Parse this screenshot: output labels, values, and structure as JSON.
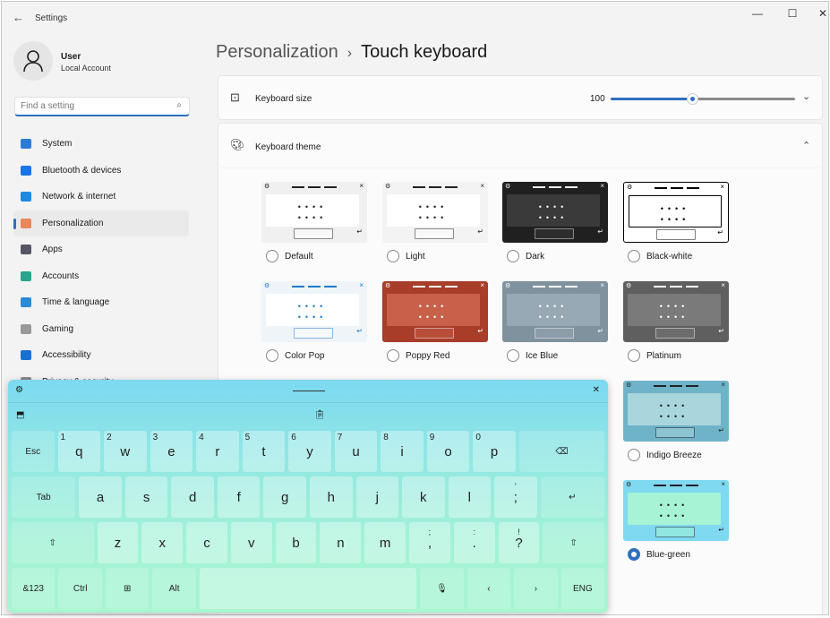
{
  "window": {
    "title": "Settings",
    "back": "←",
    "minimize": "—",
    "maximize": "☐",
    "close": "✕"
  },
  "user": {
    "name": "User",
    "account": "Local Account"
  },
  "search": {
    "placeholder": "Find a setting",
    "icon": "search-icon"
  },
  "sidebar": {
    "items": [
      {
        "label": "System",
        "color": "#2b7bd6"
      },
      {
        "label": "Bluetooth & devices",
        "color": "#1a73e8"
      },
      {
        "label": "Network & internet",
        "color": "#1e88e5"
      },
      {
        "label": "Personalization",
        "color": "#e8875a",
        "active": true
      },
      {
        "label": "Apps",
        "color": "#556"
      },
      {
        "label": "Accounts",
        "color": "#28a58e"
      },
      {
        "label": "Time & language",
        "color": "#2b8bd6"
      },
      {
        "label": "Gaming",
        "color": "#999"
      },
      {
        "label": "Accessibility",
        "color": "#1a6fd6"
      },
      {
        "label": "Privacy & security",
        "color": "#888"
      }
    ]
  },
  "breadcrumb": {
    "parent": "Personalization",
    "separator": "›",
    "current": "Touch keyboard"
  },
  "keyboard_size": {
    "label": "Keyboard size",
    "value": "100",
    "fraction": 0.44
  },
  "keyboard_theme": {
    "label": "Keyboard theme"
  },
  "themes": [
    {
      "name": "Default",
      "bg": "#f0f0f0",
      "panel": "#ffffff",
      "fg": "#222",
      "selected": false
    },
    {
      "name": "Light",
      "bg": "#f3f3f3",
      "panel": "#ffffff",
      "fg": "#222",
      "selected": false
    },
    {
      "name": "Dark",
      "bg": "#202020",
      "panel": "#3a3a3a",
      "fg": "#eee",
      "selected": false
    },
    {
      "name": "Black-white",
      "bg": "#ffffff",
      "panel": "#ffffff",
      "fg": "#000",
      "selected": false,
      "outline": true
    },
    {
      "name": "Color Pop",
      "bg": "#eef4f8",
      "panel": "#ffffff",
      "fg": "#1f7ac9",
      "selected": false
    },
    {
      "name": "Poppy Red",
      "bg": "#a83d2a",
      "panel": "#c8604a",
      "fg": "#fff",
      "selected": false
    },
    {
      "name": "Ice Blue",
      "bg": "#7f929e",
      "panel": "#97a9b4",
      "fg": "#fff",
      "selected": false
    },
    {
      "name": "Platinum",
      "bg": "#5f5f5f",
      "panel": "#7a7a7a",
      "fg": "#fff",
      "selected": false
    },
    {
      "name": "Indigo Breeze",
      "bg": "#6fb3c9",
      "panel": "#a9d6dc",
      "fg": "#222",
      "selected": false
    },
    {
      "name": "Blue-green",
      "bg": "#7fd9f0",
      "panel": "#a6f3d6",
      "fg": "#222",
      "selected": true
    }
  ],
  "touch_keyboard": {
    "settings_icon": "gear-icon",
    "close": "✕",
    "handle": "drag-handle",
    "rows": [
      [
        {
          "l": "Esc",
          "fn": true
        },
        {
          "l": "q",
          "h": "1"
        },
        {
          "l": "w",
          "h": "2"
        },
        {
          "l": "e",
          "h": "3"
        },
        {
          "l": "r",
          "h": "4"
        },
        {
          "l": "t",
          "h": "5"
        },
        {
          "l": "y",
          "h": "6"
        },
        {
          "l": "u",
          "h": "7"
        },
        {
          "l": "i",
          "h": "8"
        },
        {
          "l": "o",
          "h": "9"
        },
        {
          "l": "p",
          "h": "0"
        },
        {
          "l": "⌫",
          "fn": true,
          "w": 2
        }
      ],
      [
        {
          "l": "Tab",
          "fn": true,
          "w": 1.5
        },
        {
          "l": "a"
        },
        {
          "l": "s"
        },
        {
          "l": "d"
        },
        {
          "l": "f"
        },
        {
          "l": "g"
        },
        {
          "l": "h"
        },
        {
          "l": "j"
        },
        {
          "l": "k"
        },
        {
          "l": "l"
        },
        {
          "l": ";",
          "t": "'"
        },
        {
          "l": "↵",
          "fn": true,
          "w": 1.5
        }
      ],
      [
        {
          "l": "⇧",
          "fn": true,
          "w": 2
        },
        {
          "l": "z"
        },
        {
          "l": "x"
        },
        {
          "l": "c"
        },
        {
          "l": "v"
        },
        {
          "l": "b"
        },
        {
          "l": "n"
        },
        {
          "l": "m"
        },
        {
          "l": ",",
          "t": ";"
        },
        {
          "l": ".",
          "t": ":"
        },
        {
          "l": "?",
          "t": "!"
        },
        {
          "l": "⇧",
          "fn": true,
          "w": 1.5
        }
      ],
      [
        {
          "l": "&123",
          "fn": true
        },
        {
          "l": "Ctrl",
          "fn": true
        },
        {
          "l": "⊞",
          "fn": true
        },
        {
          "l": "Alt",
          "fn": true
        },
        {
          "l": "",
          "w": 5
        },
        {
          "l": "🎙",
          "fn": true
        },
        {
          "l": "‹",
          "fn": true
        },
        {
          "l": "›",
          "fn": true
        },
        {
          "l": "ENG",
          "fn": true
        }
      ]
    ]
  }
}
